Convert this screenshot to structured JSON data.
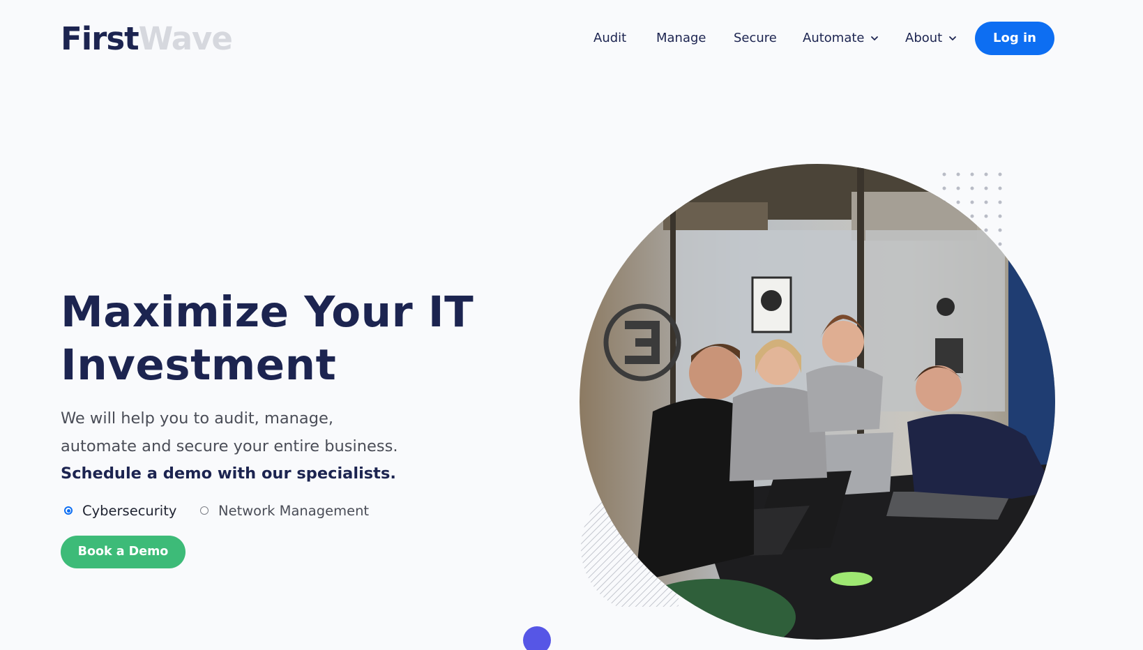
{
  "brand": {
    "logo_first": "First",
    "logo_second": "Wave"
  },
  "nav": {
    "items": [
      {
        "label": "Audit",
        "has_dropdown": false
      },
      {
        "label": "Manage",
        "has_dropdown": false
      },
      {
        "label": "Secure",
        "has_dropdown": false
      },
      {
        "label": "Automate",
        "has_dropdown": true
      },
      {
        "label": "About",
        "has_dropdown": true
      }
    ],
    "login_label": "Log in"
  },
  "hero": {
    "headline_line1": "Maximize Your IT",
    "headline_line2": "Investment",
    "subtext_line1": "We will help you to audit, manage,",
    "subtext_line2": "automate and secure your entire business.",
    "cta_text": "Schedule a demo with our specialists.",
    "options": [
      {
        "label": "Cybersecurity",
        "selected": true
      },
      {
        "label": "Network Management",
        "selected": false
      }
    ],
    "demo_button_label": "Book a Demo",
    "photo_icon": "team-photo-circle"
  },
  "colors": {
    "navy": "#1c2450",
    "logo_light": "#d6d8de",
    "primary_blue": "#0d6ef2",
    "green": "#3dbb78",
    "purple": "#5656e6",
    "background": "#f9fafc"
  }
}
